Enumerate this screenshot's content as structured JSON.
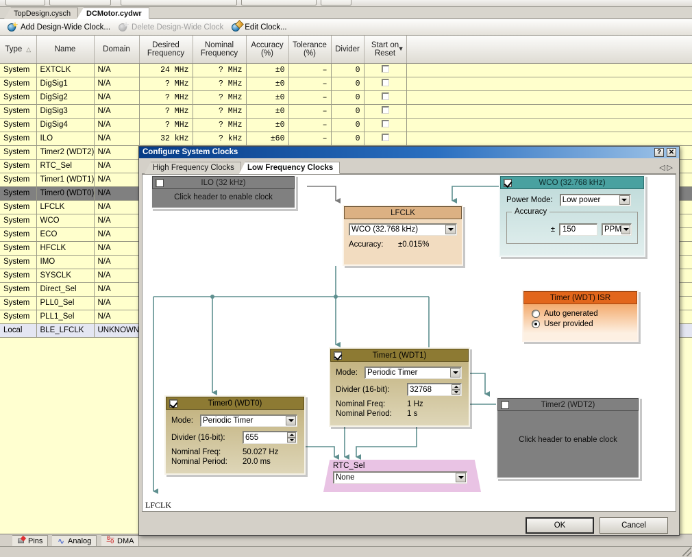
{
  "document_tabs": [
    {
      "label": "TopDesign.cysch",
      "active": false
    },
    {
      "label": "DCMotor.cydwr",
      "active": true
    }
  ],
  "clock_toolbar": {
    "add_label": "Add Design-Wide Clock...",
    "delete_label": "Delete Design-Wide Clock",
    "edit_label": "Edit Clock..."
  },
  "grid": {
    "columns": [
      "Type",
      "Name",
      "Domain",
      "Desired Frequency",
      "Nominal Frequency",
      "Accuracy (%)",
      "Tolerance (%)",
      "Divider",
      "Start on Reset",
      ""
    ],
    "sort_column": "Type",
    "sort_direction": "asc",
    "rows": [
      {
        "type": "System",
        "name": "EXTCLK",
        "domain": "N/A",
        "desired": "24 MHz",
        "nominal": "? MHz",
        "accuracy": "±0",
        "tolerance": "–",
        "divider": "0",
        "start_on_reset": false,
        "selected": false,
        "local": false
      },
      {
        "type": "System",
        "name": "DigSig1",
        "domain": "N/A",
        "desired": "? MHz",
        "nominal": "? MHz",
        "accuracy": "±0",
        "tolerance": "–",
        "divider": "0",
        "start_on_reset": false,
        "selected": false,
        "local": false
      },
      {
        "type": "System",
        "name": "DigSig2",
        "domain": "N/A",
        "desired": "? MHz",
        "nominal": "? MHz",
        "accuracy": "±0",
        "tolerance": "–",
        "divider": "0",
        "start_on_reset": false,
        "selected": false,
        "local": false
      },
      {
        "type": "System",
        "name": "DigSig3",
        "domain": "N/A",
        "desired": "? MHz",
        "nominal": "? MHz",
        "accuracy": "±0",
        "tolerance": "–",
        "divider": "0",
        "start_on_reset": false,
        "selected": false,
        "local": false
      },
      {
        "type": "System",
        "name": "DigSig4",
        "domain": "N/A",
        "desired": "? MHz",
        "nominal": "? MHz",
        "accuracy": "±0",
        "tolerance": "–",
        "divider": "0",
        "start_on_reset": false,
        "selected": false,
        "local": false
      },
      {
        "type": "System",
        "name": "ILO",
        "domain": "N/A",
        "desired": "32 kHz",
        "nominal": "? kHz",
        "accuracy": "±60",
        "tolerance": "–",
        "divider": "0",
        "start_on_reset": false,
        "selected": false,
        "local": false
      },
      {
        "type": "System",
        "name": "Timer2 (WDT2)",
        "domain": "N/A",
        "desired": "",
        "nominal": "",
        "accuracy": "",
        "tolerance": "",
        "divider": "",
        "start_on_reset": false,
        "selected": false,
        "local": false
      },
      {
        "type": "System",
        "name": "RTC_Sel",
        "domain": "N/A",
        "desired": "",
        "nominal": "",
        "accuracy": "",
        "tolerance": "",
        "divider": "",
        "start_on_reset": false,
        "selected": false,
        "local": false
      },
      {
        "type": "System",
        "name": "Timer1 (WDT1)",
        "domain": "N/A",
        "desired": "",
        "nominal": "",
        "accuracy": "",
        "tolerance": "",
        "divider": "",
        "start_on_reset": false,
        "selected": false,
        "local": false
      },
      {
        "type": "System",
        "name": "Timer0 (WDT0)",
        "domain": "N/A",
        "desired": "",
        "nominal": "",
        "accuracy": "",
        "tolerance": "",
        "divider": "",
        "start_on_reset": false,
        "selected": true,
        "local": false
      },
      {
        "type": "System",
        "name": "LFCLK",
        "domain": "N/A",
        "desired": "",
        "nominal": "",
        "accuracy": "",
        "tolerance": "",
        "divider": "",
        "start_on_reset": false,
        "selected": false,
        "local": false
      },
      {
        "type": "System",
        "name": "WCO",
        "domain": "N/A",
        "desired": "",
        "nominal": "",
        "accuracy": "",
        "tolerance": "",
        "divider": "",
        "start_on_reset": false,
        "selected": false,
        "local": false
      },
      {
        "type": "System",
        "name": "ECO",
        "domain": "N/A",
        "desired": "",
        "nominal": "",
        "accuracy": "",
        "tolerance": "",
        "divider": "",
        "start_on_reset": false,
        "selected": false,
        "local": false
      },
      {
        "type": "System",
        "name": "HFCLK",
        "domain": "N/A",
        "desired": "",
        "nominal": "",
        "accuracy": "",
        "tolerance": "",
        "divider": "",
        "start_on_reset": false,
        "selected": false,
        "local": false
      },
      {
        "type": "System",
        "name": "IMO",
        "domain": "N/A",
        "desired": "",
        "nominal": "",
        "accuracy": "",
        "tolerance": "",
        "divider": "",
        "start_on_reset": false,
        "selected": false,
        "local": false
      },
      {
        "type": "System",
        "name": "SYSCLK",
        "domain": "N/A",
        "desired": "",
        "nominal": "",
        "accuracy": "",
        "tolerance": "",
        "divider": "",
        "start_on_reset": false,
        "selected": false,
        "local": false
      },
      {
        "type": "System",
        "name": "Direct_Sel",
        "domain": "N/A",
        "desired": "",
        "nominal": "",
        "accuracy": "",
        "tolerance": "",
        "divider": "",
        "start_on_reset": false,
        "selected": false,
        "local": false
      },
      {
        "type": "System",
        "name": "PLL0_Sel",
        "domain": "N/A",
        "desired": "",
        "nominal": "",
        "accuracy": "",
        "tolerance": "",
        "divider": "",
        "start_on_reset": false,
        "selected": false,
        "local": false
      },
      {
        "type": "System",
        "name": "PLL1_Sel",
        "domain": "N/A",
        "desired": "",
        "nominal": "",
        "accuracy": "",
        "tolerance": "",
        "divider": "",
        "start_on_reset": false,
        "selected": false,
        "local": false
      },
      {
        "type": "Local",
        "name": "BLE_LFCLK",
        "domain": "UNKNOWN",
        "desired": "",
        "nominal": "",
        "accuracy": "",
        "tolerance": "",
        "divider": "",
        "start_on_reset": false,
        "selected": false,
        "local": true
      }
    ]
  },
  "bottom_tabs": [
    {
      "label": "Pins",
      "icon": "pins-icon"
    },
    {
      "label": "Analog",
      "icon": "analog-icon"
    },
    {
      "label": "DMA",
      "icon": "dma-icon"
    }
  ],
  "dialog": {
    "title": "Configure System Clocks",
    "help_button": "?",
    "close_button": "✕",
    "tabs": [
      {
        "label": "High Frequency Clocks",
        "active": false
      },
      {
        "label": "Low Frequency Clocks",
        "active": true
      }
    ],
    "tab_nav_prev": "◁",
    "tab_nav_next": "▷",
    "canvas_label": "LFCLK",
    "nodes": {
      "ilo": {
        "header": "ILO (32 kHz)",
        "enabled": false,
        "body_text": "Click header to enable clock"
      },
      "wco": {
        "header": "WCO (32.768 kHz)",
        "enabled": true,
        "power_mode_label": "Power Mode:",
        "power_mode_value": "Low power",
        "accuracy_group": "Accuracy",
        "plusminus": "±",
        "accuracy_value": "150",
        "accuracy_unit": "PPM"
      },
      "lfclk": {
        "header": "LFCLK",
        "source_value": "WCO (32.768 kHz)",
        "accuracy_label": "Accuracy:",
        "accuracy_value": "±0.015%"
      },
      "isr": {
        "header": "Timer (WDT) ISR",
        "option_auto": "Auto generated",
        "option_user": "User provided",
        "selected": "User provided"
      },
      "timer1": {
        "header": "Timer1 (WDT1)",
        "enabled": true,
        "mode_label": "Mode:",
        "mode_value": "Periodic Timer",
        "divider_label": "Divider (16-bit):",
        "divider_value": "32768",
        "nominal_freq_label": "Nominal Freq:",
        "nominal_freq_value": "1  Hz",
        "nominal_period_label": "Nominal Period:",
        "nominal_period_value": "1 s"
      },
      "timer0": {
        "header": "Timer0 (WDT0)",
        "enabled": true,
        "mode_label": "Mode:",
        "mode_value": "Periodic Timer",
        "divider_label": "Divider (16-bit):",
        "divider_value": "655",
        "nominal_freq_label": "Nominal Freq:",
        "nominal_freq_value": "50.027  Hz",
        "nominal_period_label": "Nominal Period:",
        "nominal_period_value": "20.0 ms"
      },
      "timer2": {
        "header": "Timer2 (WDT2)",
        "enabled": false,
        "body_text": "Click header to enable clock"
      },
      "rtc_sel": {
        "label": "RTC_Sel",
        "value": "None"
      }
    },
    "buttons": {
      "ok": "OK",
      "cancel": "Cancel"
    }
  },
  "colors": {
    "title_bar": "#063b86",
    "wire": "#5e8f8f",
    "lfclk_header": "#dcb183",
    "wco_header": "#49a1a0",
    "timer_header": "#8d7a33",
    "isr_header": "#e2661b",
    "mux_fill": "#e9c3e4",
    "grid_row": "#ffffcc",
    "selected_row": "#808080"
  }
}
